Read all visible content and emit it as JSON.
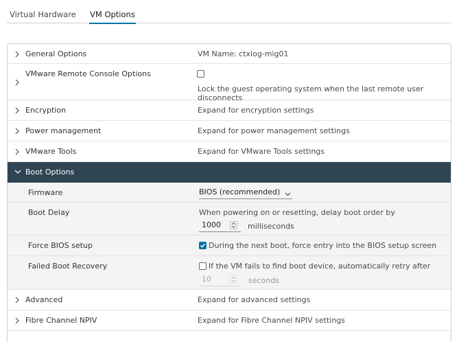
{
  "tabs": [
    {
      "label": "Virtual Hardware",
      "active": false
    },
    {
      "label": "VM Options",
      "active": true
    }
  ],
  "rows": {
    "general": {
      "label": "General Options",
      "value": "VM Name: ctxlog-mig01"
    },
    "vmrc": {
      "label": "VMware Remote Console Options",
      "checkbox_checked": false,
      "value": "Lock the guest operating system when the last remote user disconnects"
    },
    "encryption": {
      "label": "Encryption",
      "value": "Expand for encryption settings"
    },
    "power": {
      "label": "Power management",
      "value": "Expand for power management settings"
    },
    "tools": {
      "label": "VMware Tools",
      "value": "Expand for VMware Tools settings"
    },
    "boot": {
      "label": "Boot Options",
      "firmware": {
        "label": "Firmware",
        "selected": "BIOS (recommended)"
      },
      "delay": {
        "label": "Boot Delay",
        "description": "When powering on or resetting, delay boot order by",
        "value": "1000",
        "units": "milliseconds"
      },
      "force_bios": {
        "label": "Force BIOS setup",
        "checked": true,
        "text": "During the next boot, force entry into the BIOS setup screen"
      },
      "failed_recovery": {
        "label": "Failed Boot Recovery",
        "checked": false,
        "text": "If the VM fails to find boot device, automatically retry after",
        "value": "10",
        "units": "seconds"
      }
    },
    "advanced": {
      "label": "Advanced",
      "value": "Expand for advanced settings"
    },
    "fibre": {
      "label": "Fibre Channel NPIV",
      "value": "Expand for Fibre Channel NPIV settings"
    }
  },
  "colors": {
    "accent": "#0072a3",
    "header_dark": "#2f4554"
  }
}
